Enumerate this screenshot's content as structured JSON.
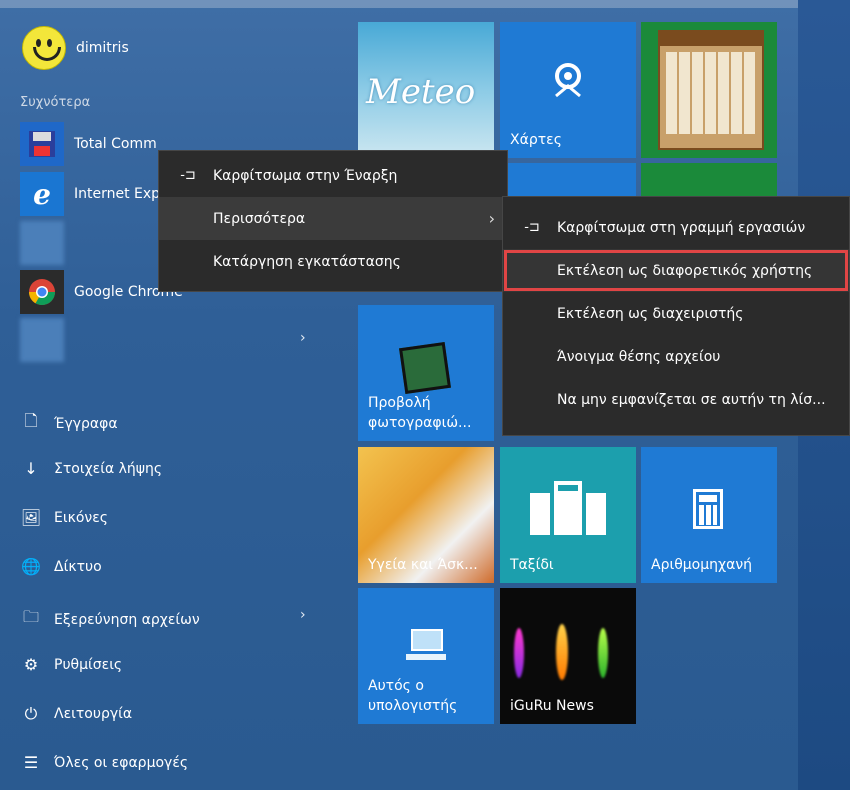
{
  "user": {
    "name": "dimitris"
  },
  "sections": {
    "frequent": "Συχνότερα"
  },
  "apps": [
    {
      "label": "Total Comm",
      "icon": "floppy-icon",
      "color": "#1f68c8"
    },
    {
      "label": "Internet Exp",
      "icon": "internet-explorer-icon",
      "color": "#1a76d2"
    },
    {
      "label": "",
      "icon": "blurred-app-icon",
      "color": "#4b7fb9"
    },
    {
      "label": "Google Chrome",
      "icon": "chrome-icon",
      "color": "#2b2b2b"
    },
    {
      "label": "",
      "icon": "blurred-app-icon",
      "color": "#4b7fb9"
    }
  ],
  "nav": [
    {
      "label": "Έγγραφα",
      "icon": "document-icon",
      "glyph": "🗋"
    },
    {
      "label": "Στοιχεία λήψης",
      "icon": "download-icon",
      "glyph": "↓"
    },
    {
      "label": "Εικόνες",
      "icon": "pictures-icon",
      "glyph": "🖼"
    },
    {
      "label": "Δίκτυο",
      "icon": "network-icon",
      "glyph": "🌐"
    },
    {
      "label": "Εξερεύνηση αρχείων",
      "icon": "folder-icon",
      "glyph": "🗀"
    },
    {
      "label": "Ρυθμίσεις",
      "icon": "gear-icon",
      "glyph": "⚙"
    },
    {
      "label": "Λειτουργία",
      "icon": "power-icon",
      "glyph": "⏻"
    },
    {
      "label": "Όλες οι εφαρμογές",
      "icon": "all-apps-icon",
      "glyph": "☰"
    }
  ],
  "tiles": [
    {
      "label": "Meteo",
      "name": "tile-meteo"
    },
    {
      "label": "Χάρτες",
      "name": "tile-maps"
    },
    {
      "label": "",
      "name": "tile-calendar"
    },
    {
      "label": "Προβολή φωτογραφιώ...",
      "name": "tile-photo-viewer"
    },
    {
      "label": "Υγεία και Άσκ...",
      "name": "tile-health"
    },
    {
      "label": "Ταξίδι",
      "name": "tile-travel"
    },
    {
      "label": "Αριθμομηχανή",
      "name": "tile-calculator"
    },
    {
      "label": "Αυτός ο υπολογιστής",
      "name": "tile-this-pc"
    },
    {
      "label": "iGuRu News",
      "name": "tile-iguru"
    }
  ],
  "context_menu": {
    "pin_start": "Καρφίτσωμα στην Έναρξη",
    "more": "Περισσότερα",
    "uninstall": "Κατάργηση εγκατάστασης"
  },
  "submenu": {
    "pin_taskbar": "Καρφίτσωμα στη γραμμή εργασιών",
    "run_as_other": "Εκτέλεση ως διαφορετικός χρήστης",
    "run_as_admin": "Εκτέλεση ως διαχειριστής",
    "open_location": "Άνοιγμα θέσης αρχείου",
    "hide_list": "Να μην εμφανίζεται σε αυτήν τη λίσ..."
  }
}
